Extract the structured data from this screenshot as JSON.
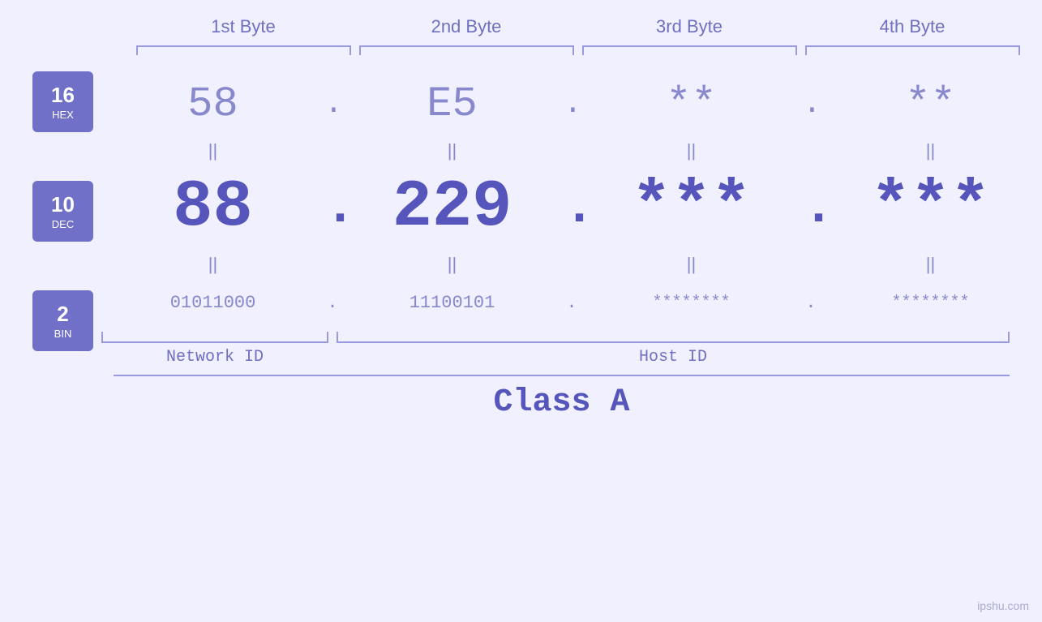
{
  "headers": {
    "byte1": "1st Byte",
    "byte2": "2nd Byte",
    "byte3": "3rd Byte",
    "byte4": "4th Byte"
  },
  "badges": {
    "hex": {
      "num": "16",
      "label": "HEX"
    },
    "dec": {
      "num": "10",
      "label": "DEC"
    },
    "bin": {
      "num": "2",
      "label": "BIN"
    }
  },
  "hex_row": {
    "b1": "58",
    "b2": "E5",
    "b3": "**",
    "b4": "**",
    "dot": "."
  },
  "dec_row": {
    "b1": "88",
    "b2": "229",
    "b3": "***",
    "b4": "***",
    "dot": "."
  },
  "bin_row": {
    "b1": "01011000",
    "b2": "11100101",
    "b3": "********",
    "b4": "********",
    "dot": "."
  },
  "labels": {
    "network_id": "Network ID",
    "host_id": "Host ID",
    "class": "Class A"
  },
  "watermark": "ipshu.com"
}
